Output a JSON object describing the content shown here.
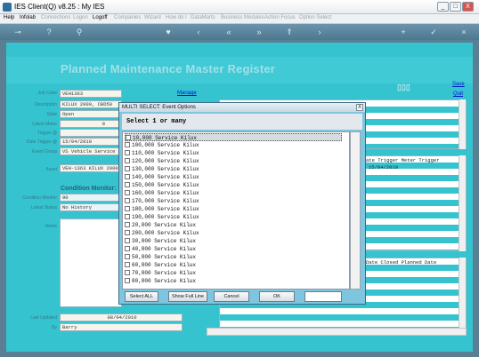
{
  "window": {
    "title": "IES Client(Q) v8.25 : My IES",
    "buttons": [
      "_",
      "□",
      "X"
    ]
  },
  "menu": [
    "Help",
    "Infolab",
    "Connections",
    "Logon",
    "Logoff",
    "Companies",
    "Wizard",
    "How do I",
    "DataMarts",
    "Business Modules",
    "Action Focus",
    "Option Select"
  ],
  "page": {
    "heading": "Planned Maintenance Master Register",
    "manage": "Manage",
    "save": "Save",
    "quit": "Quit"
  },
  "form": {
    "job_code": {
      "label": "Job Code",
      "value": "VEH1363"
    },
    "description": {
      "label": "Description",
      "value": "KILUX 2000, CBD50"
    },
    "state": {
      "label": "State",
      "value": "Open"
    },
    "latest_meter": {
      "label": "Latest Meter",
      "value": "0"
    },
    "trigger": {
      "label": "Trigger @",
      "value": ""
    },
    "date_trigger": {
      "label": "Date Trigger @",
      "value": "15/04/2010"
    },
    "event_group": {
      "label": "Event Group",
      "value": "VS Vehicle Service"
    },
    "asset": {
      "label": "Asset",
      "value": "VEH-1363 KILUX 2000"
    },
    "condition_title": "Condition Monitor:",
    "condition_monitor": {
      "label": "Condition Monitor",
      "value": "90"
    },
    "latest_status": {
      "label": "Latest Status",
      "value": "No History"
    },
    "notes": {
      "label": "Notes"
    },
    "last_updated": {
      "label": "Last Updated",
      "value": "08/04/2010"
    },
    "by": {
      "label": "By",
      "value": "Barry"
    }
  },
  "grids": {
    "upper_headers": "ate Trigger  Meter Trigger",
    "upper_row1": "15/04/2010",
    "lower_headers": "Date Closed  Planned       Date"
  },
  "modal": {
    "title": "MULTI SELECT: Event Options",
    "close": "X",
    "heading": "Select 1 or many",
    "options": [
      "10,000 Service Kilux",
      "100,000 Service Kilux",
      "110,000 Service Kilux",
      "120,000 Service Kilux",
      "130,000 Service Kilux",
      "140,000 Service Kilux",
      "150,000 Service Kilux",
      "160,000 Service Kilux",
      "170,000 Service Kilux",
      "180,000 Service Kilux",
      "190,000 Service Kilux",
      "20,000 Service Kilux",
      "200,000 Service Kilux",
      "30,000 Service Kilux",
      "40,000 Service Kilux",
      "50,000 Service Kilux",
      "60,000 Service Kilux",
      "70,000 Service Kilux",
      "80,000 Service Kilux"
    ],
    "buttons": {
      "select_all": "Select ALL",
      "full_line": "Show Full Line",
      "cancel": "Cancel",
      "ok": "OK"
    }
  }
}
